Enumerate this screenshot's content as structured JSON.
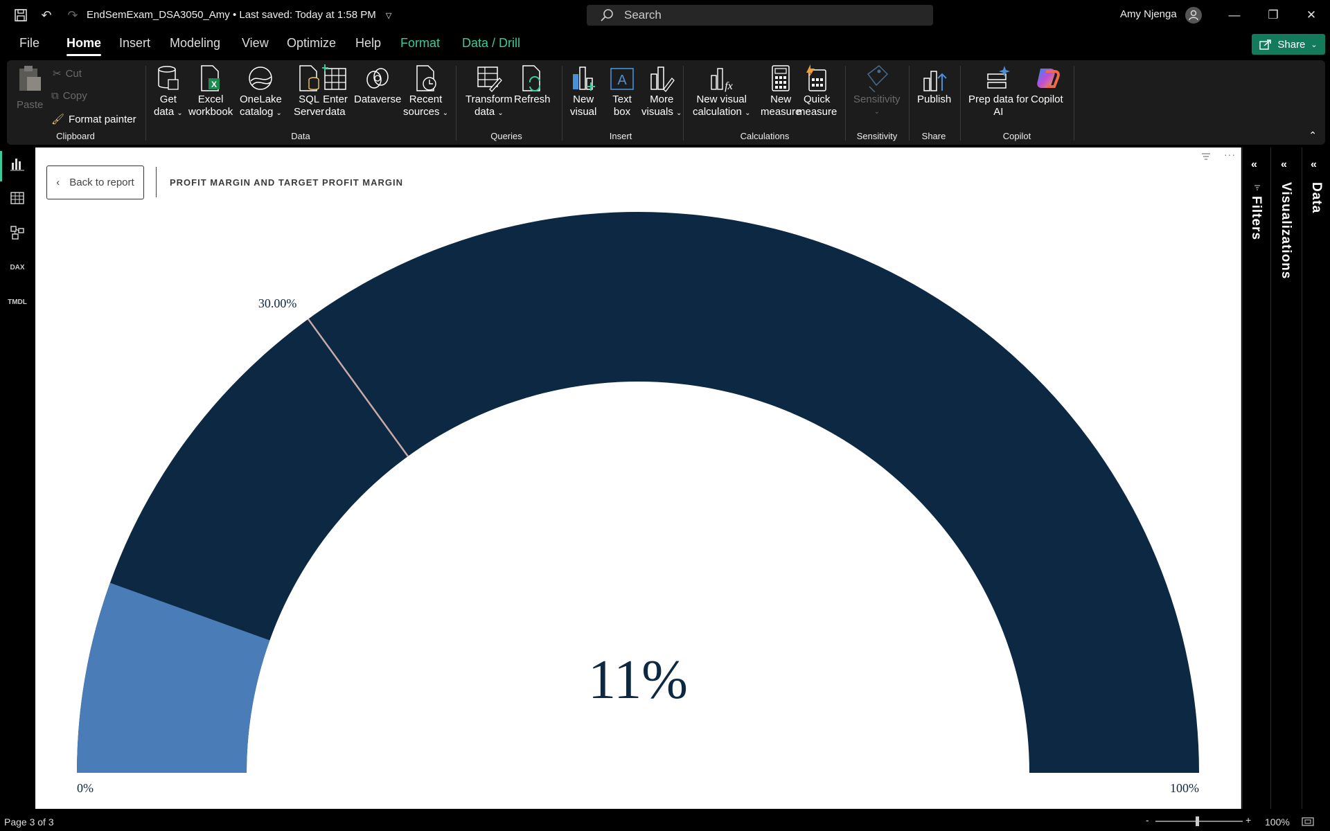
{
  "titlebar": {
    "doc_title": "EndSemExam_DSA3050_Amy • Last saved: Today at 1:58 PM",
    "search_placeholder": "Search",
    "user_name": "Amy Njenga"
  },
  "menu": {
    "file": "File",
    "home": "Home",
    "insert": "Insert",
    "modeling": "Modeling",
    "view": "View",
    "optimize": "Optimize",
    "help": "Help",
    "format": "Format",
    "data_drill": "Data / Drill",
    "share": "Share"
  },
  "ribbon": {
    "clipboard": {
      "paste": "Paste",
      "cut": "Cut",
      "copy": "Copy",
      "format_painter": "Format painter",
      "label": "Clipboard"
    },
    "data": {
      "get_data": [
        "Get",
        "data"
      ],
      "excel": [
        "Excel",
        "workbook"
      ],
      "onelake": [
        "OneLake",
        "catalog"
      ],
      "sql": [
        "SQL",
        "Server"
      ],
      "enter": [
        "Enter",
        "data"
      ],
      "dataverse": [
        "Dataverse",
        ""
      ],
      "recent": [
        "Recent",
        "sources"
      ],
      "label": "Data"
    },
    "queries": {
      "transform": [
        "Transform",
        "data"
      ],
      "refresh": [
        "Refresh",
        ""
      ],
      "label": "Queries"
    },
    "insert": {
      "new_visual": [
        "New",
        "visual"
      ],
      "text_box": [
        "Text",
        "box"
      ],
      "more_visuals": [
        "More",
        "visuals"
      ],
      "label": "Insert"
    },
    "calculations": {
      "new_visual_calc": [
        "New visual",
        "calculation"
      ],
      "new_measure": [
        "New",
        "measure"
      ],
      "quick_measure": [
        "Quick",
        "measure"
      ],
      "label": "Calculations"
    },
    "sensitivity": {
      "sensitivity": "Sensitivity",
      "label": "Sensitivity"
    },
    "share": {
      "publish": "Publish",
      "label": "Share"
    },
    "copilot": {
      "prep": [
        "Prep data for",
        "AI"
      ],
      "copilot": "Copilot",
      "label": "Copilot"
    }
  },
  "left_rail": {
    "report_icon": "report-view-icon",
    "table_icon": "table-view-icon",
    "model_icon": "model-view-icon",
    "dax": "DAX",
    "tmdl": "TMDL"
  },
  "canvas": {
    "back_label": "Back to report",
    "visual_title": "PROFIT MARGIN AND TARGET PROFIT MARGIN"
  },
  "panes": {
    "filters": "Filters",
    "visualizations": "Visualizations",
    "data": "Data"
  },
  "statusbar": {
    "page": "Page 3 of 3",
    "zoom": "100%"
  },
  "chart_data": {
    "type": "gauge",
    "value": 0.11,
    "value_label": "11%",
    "min": 0,
    "max": 1,
    "min_label": "0%",
    "max_label": "100%",
    "target": 0.3,
    "target_label": "30.00%",
    "colors": {
      "fill": "#4a7db8",
      "track": "#0d2843",
      "target_line": "#c9a9a9",
      "label": "#0d2843"
    }
  }
}
